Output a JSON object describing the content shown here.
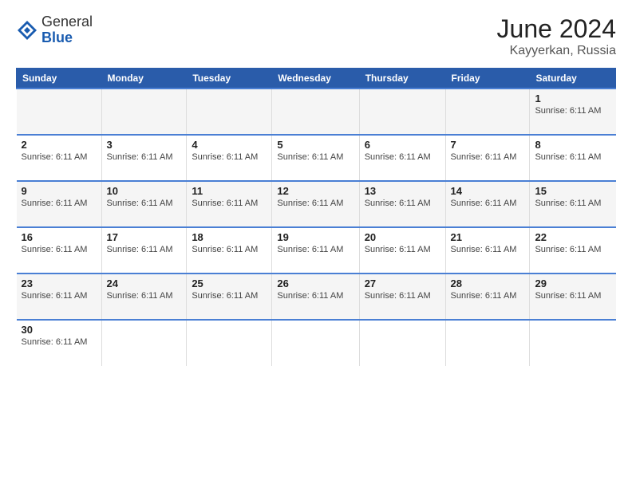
{
  "header": {
    "logo_general": "General",
    "logo_blue": "Blue",
    "month_year": "June 2024",
    "location": "Kayyerkan, Russia"
  },
  "days_of_week": [
    "Sunday",
    "Monday",
    "Tuesday",
    "Wednesday",
    "Thursday",
    "Friday",
    "Saturday"
  ],
  "sunrise_label": "Sunrise: 6:11 AM",
  "weeks": [
    {
      "days": [
        {
          "number": "",
          "sunrise": ""
        },
        {
          "number": "",
          "sunrise": ""
        },
        {
          "number": "",
          "sunrise": ""
        },
        {
          "number": "",
          "sunrise": ""
        },
        {
          "number": "",
          "sunrise": ""
        },
        {
          "number": "",
          "sunrise": ""
        },
        {
          "number": "1",
          "sunrise": "Sunrise: 6:11 AM"
        }
      ]
    },
    {
      "days": [
        {
          "number": "2",
          "sunrise": "Sunrise: 6:11 AM"
        },
        {
          "number": "3",
          "sunrise": "Sunrise: 6:11 AM"
        },
        {
          "number": "4",
          "sunrise": "Sunrise: 6:11 AM"
        },
        {
          "number": "5",
          "sunrise": "Sunrise: 6:11 AM"
        },
        {
          "number": "6",
          "sunrise": "Sunrise: 6:11 AM"
        },
        {
          "number": "7",
          "sunrise": "Sunrise: 6:11 AM"
        },
        {
          "number": "8",
          "sunrise": "Sunrise: 6:11 AM"
        }
      ]
    },
    {
      "days": [
        {
          "number": "9",
          "sunrise": "Sunrise: 6:11 AM"
        },
        {
          "number": "10",
          "sunrise": "Sunrise: 6:11 AM"
        },
        {
          "number": "11",
          "sunrise": "Sunrise: 6:11 AM"
        },
        {
          "number": "12",
          "sunrise": "Sunrise: 6:11 AM"
        },
        {
          "number": "13",
          "sunrise": "Sunrise: 6:11 AM"
        },
        {
          "number": "14",
          "sunrise": "Sunrise: 6:11 AM"
        },
        {
          "number": "15",
          "sunrise": "Sunrise: 6:11 AM"
        }
      ]
    },
    {
      "days": [
        {
          "number": "16",
          "sunrise": "Sunrise: 6:11 AM"
        },
        {
          "number": "17",
          "sunrise": "Sunrise: 6:11 AM"
        },
        {
          "number": "18",
          "sunrise": "Sunrise: 6:11 AM"
        },
        {
          "number": "19",
          "sunrise": "Sunrise: 6:11 AM"
        },
        {
          "number": "20",
          "sunrise": "Sunrise: 6:11 AM"
        },
        {
          "number": "21",
          "sunrise": "Sunrise: 6:11 AM"
        },
        {
          "number": "22",
          "sunrise": "Sunrise: 6:11 AM"
        }
      ]
    },
    {
      "days": [
        {
          "number": "23",
          "sunrise": "Sunrise: 6:11 AM"
        },
        {
          "number": "24",
          "sunrise": "Sunrise: 6:11 AM"
        },
        {
          "number": "25",
          "sunrise": "Sunrise: 6:11 AM"
        },
        {
          "number": "26",
          "sunrise": "Sunrise: 6:11 AM"
        },
        {
          "number": "27",
          "sunrise": "Sunrise: 6:11 AM"
        },
        {
          "number": "28",
          "sunrise": "Sunrise: 6:11 AM"
        },
        {
          "number": "29",
          "sunrise": "Sunrise: 6:11 AM"
        }
      ]
    },
    {
      "days": [
        {
          "number": "30",
          "sunrise": "Sunrise: 6:11 AM"
        },
        {
          "number": "",
          "sunrise": ""
        },
        {
          "number": "",
          "sunrise": ""
        },
        {
          "number": "",
          "sunrise": ""
        },
        {
          "number": "",
          "sunrise": ""
        },
        {
          "number": "",
          "sunrise": ""
        },
        {
          "number": "",
          "sunrise": ""
        }
      ]
    }
  ]
}
